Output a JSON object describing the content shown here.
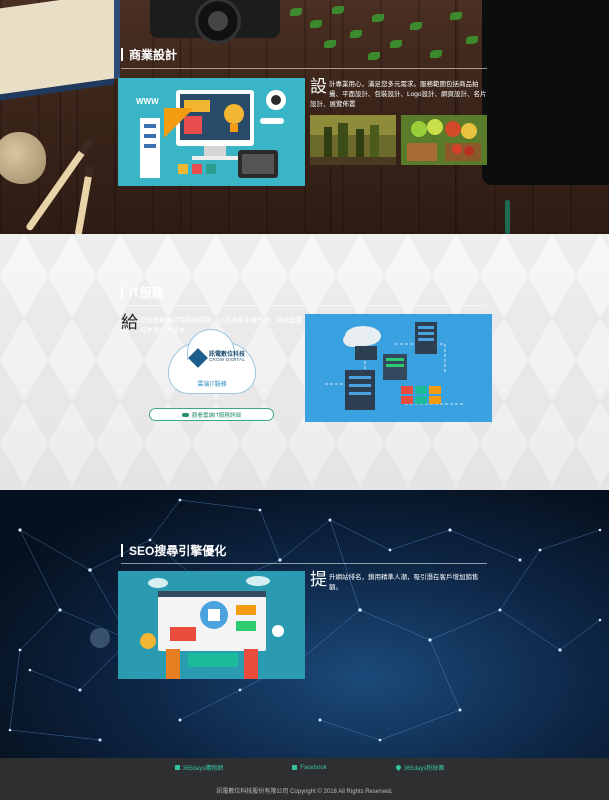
{
  "design": {
    "title": "商業設計",
    "drop_letter": "設",
    "description": "計專業用心，滿足您多元需求。服務範圍包括商品拍攝、平面設計、包裝設計、Logo設計、網頁設計、名片設計、展覽佈置",
    "illustration_label": "WWW"
  },
  "it": {
    "title": "IT服務",
    "drop_letter": "給",
    "description": "您端應統機房高然異環境、以及虛擬主機代管，降低建置成本及人力成本",
    "logo_name": "訊電數位科技",
    "logo_en": "CROW DIGITAL",
    "logo_sub": "雲端IT服務",
    "button_label": "觀看雲端IT服務詳細"
  },
  "seo": {
    "title": "SEO搜尋引擎優化",
    "drop_letter": "提",
    "description": "升網站排名，鎖用精準人潮，吸引潛在客戶增加銷售額。"
  },
  "footer": {
    "links": [
      {
        "label": "365days購物網",
        "icon": "cart-icon"
      },
      {
        "label": "Facebook",
        "icon": "thumbs-up-icon"
      },
      {
        "label": "365days粉絲團",
        "icon": "heart-icon"
      }
    ],
    "copyright": "訊電數位科技股份有限公司 Copyright © 2018 All Rights Reserved."
  }
}
